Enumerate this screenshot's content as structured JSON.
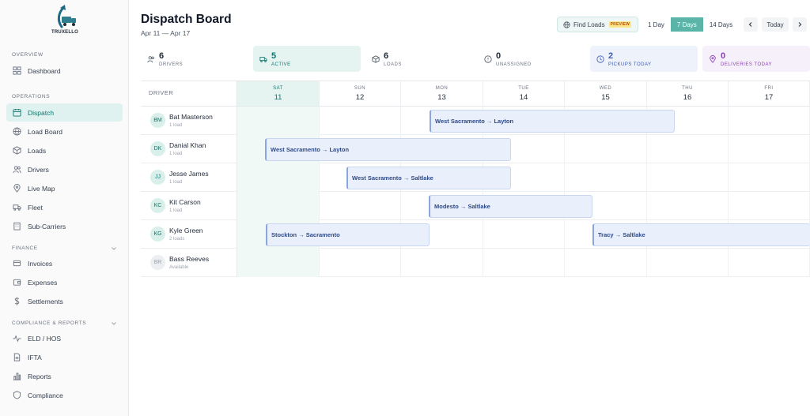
{
  "brand": {
    "name": "TRUXELLO"
  },
  "sidebar": {
    "sections": [
      {
        "label": "OVERVIEW"
      },
      {
        "label": "OPERATIONS"
      },
      {
        "label": "FINANCE"
      },
      {
        "label": "COMPLIANCE & REPORTS"
      }
    ],
    "items": [
      {
        "label": "Dashboard",
        "icon": "grid-icon"
      },
      {
        "label": "Dispatch",
        "icon": "calendar-icon",
        "active": true
      },
      {
        "label": "Load Board",
        "icon": "globe-icon"
      },
      {
        "label": "Loads",
        "icon": "box-icon"
      },
      {
        "label": "Drivers",
        "icon": "users-icon"
      },
      {
        "label": "Live Map",
        "icon": "map-pin-icon"
      },
      {
        "label": "Fleet",
        "icon": "truck-icon"
      },
      {
        "label": "Sub-Carriers",
        "icon": "building-icon"
      },
      {
        "label": "Invoices",
        "icon": "invoice-icon"
      },
      {
        "label": "Expenses",
        "icon": "wallet-icon"
      },
      {
        "label": "Settlements",
        "icon": "dollar-icon"
      },
      {
        "label": "ELD / HOS",
        "icon": "pulse-icon"
      },
      {
        "label": "IFTA",
        "icon": "document-icon"
      },
      {
        "label": "Reports",
        "icon": "bar-chart-icon"
      },
      {
        "label": "Compliance",
        "icon": "shield-icon"
      }
    ]
  },
  "header": {
    "title": "Dispatch Board",
    "subtitle": "Apr 11 — Apr 17",
    "find_loads": "Find Loads",
    "preview": "PREVIEW",
    "ranges": [
      "1 Day",
      "7 Days",
      "14 Days"
    ],
    "active_range": "7 Days",
    "today": "Today"
  },
  "stats": [
    {
      "value": "6",
      "label": "DRIVERS"
    },
    {
      "value": "5",
      "label": "ACTIVE"
    },
    {
      "value": "6",
      "label": "LOADS"
    },
    {
      "value": "0",
      "label": "UNASSIGNED"
    },
    {
      "value": "2",
      "label": "PICKUPS TODAY"
    },
    {
      "value": "0",
      "label": "DELIVERIES TODAY"
    }
  ],
  "grid": {
    "driver_header": "DRIVER",
    "days": [
      {
        "dow": "SAT",
        "num": "11",
        "today": true
      },
      {
        "dow": "SUN",
        "num": "12"
      },
      {
        "dow": "MON",
        "num": "13"
      },
      {
        "dow": "TUE",
        "num": "14"
      },
      {
        "dow": "WED",
        "num": "15"
      },
      {
        "dow": "THU",
        "num": "16"
      },
      {
        "dow": "FRI",
        "num": "17"
      }
    ],
    "drivers": [
      {
        "initials": "BM",
        "name": "Bat Masterson",
        "sub": "1 load"
      },
      {
        "initials": "DK",
        "name": "Danial Khan",
        "sub": "1 load"
      },
      {
        "initials": "JJ",
        "name": "Jesse James",
        "sub": "1 load"
      },
      {
        "initials": "KC",
        "name": "Kit Carson",
        "sub": "1 load"
      },
      {
        "initials": "KG",
        "name": "Kyle Green",
        "sub": "2 loads"
      },
      {
        "initials": "BR",
        "name": "Bass Reeves",
        "sub": "Available"
      }
    ],
    "loads": [
      {
        "label": "West Sacramento → Layton",
        "driver": "Bat Masterson",
        "start": "MON 13",
        "end": "WED 15"
      },
      {
        "label": "West Sacramento → Layton",
        "driver": "Danial Khan",
        "start": "SAT 11",
        "end": "MON 13"
      },
      {
        "label": "West Sacramento → Saltlake",
        "driver": "Jesse James",
        "start": "SUN 12",
        "end": "MON 13"
      },
      {
        "label": "Modesto → Saltlake",
        "driver": "Kit Carson",
        "start": "MON 13",
        "end": "TUE 14"
      },
      {
        "label": "Stockton → Sacramento",
        "driver": "Kyle Green",
        "start": "SAT 11",
        "end": "SUN 12"
      },
      {
        "label": "Tracy → Saltlake",
        "driver": "Kyle Green",
        "start": "WED 15",
        "end": "FRI 17"
      }
    ]
  }
}
